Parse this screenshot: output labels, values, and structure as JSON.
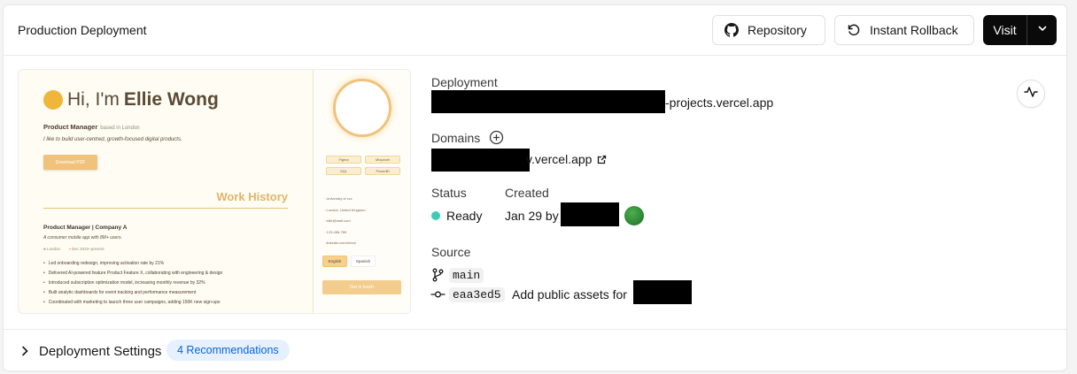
{
  "header": {
    "title": "Production Deployment",
    "repository_label": "Repository",
    "rollback_label": "Instant Rollback",
    "visit_label": "Visit"
  },
  "preview": {
    "greeting": "Hi, I'm",
    "name": "Ellie Wong",
    "role": "Product Manager",
    "location_note": "based in London",
    "tagline": "I like to build user-centred, growth-focused digital products.",
    "download_label": "Download PDF",
    "work_history": "Work History",
    "job_title": "Product Manager | Company A",
    "job_desc": "A consumer mobile app with 8M+ users.",
    "job_location": "London",
    "job_dates": "Dec 2022–present",
    "bullets": [
      "Led onboarding redesign, improving activation rate by 21%",
      "Delivered AI-powered feature Product Feature X, collaborating with engineering & design",
      "Introduced subscription optimization model, increasing monthly revenue by 32%",
      "Built analytic dashboards for event tracking and performance measurement",
      "Coordinated with marketing to launch three user campaigns, adding 150K new sign-ups"
    ],
    "skills": [
      "Figma",
      "Mixpanel",
      "SQL",
      "PowerBI"
    ],
    "contact": [
      "University of xxx",
      "London, United Kingdom",
      "ellie@mail.com",
      "123-456-789",
      "linkedin.com/in/xxx"
    ],
    "lang_on": "English",
    "lang_off": "Spanish",
    "cta": "Get in touch"
  },
  "details": {
    "deployment_label": "Deployment",
    "deployment_suffix": "-projects.vercel.app",
    "domains_label": "Domains",
    "domain_suffix": "v.vercel.app",
    "status_label": "Status",
    "status_value": "Ready",
    "status_color": "#3ccbb4",
    "created_label": "Created",
    "created_value": "Jan 29 by",
    "source_label": "Source",
    "branch": "main",
    "commit_hash": "eaa3ed5",
    "commit_message": "Add public assets for"
  },
  "footer": {
    "settings_label": "Deployment Settings",
    "recommendations": "4 Recommendations"
  }
}
